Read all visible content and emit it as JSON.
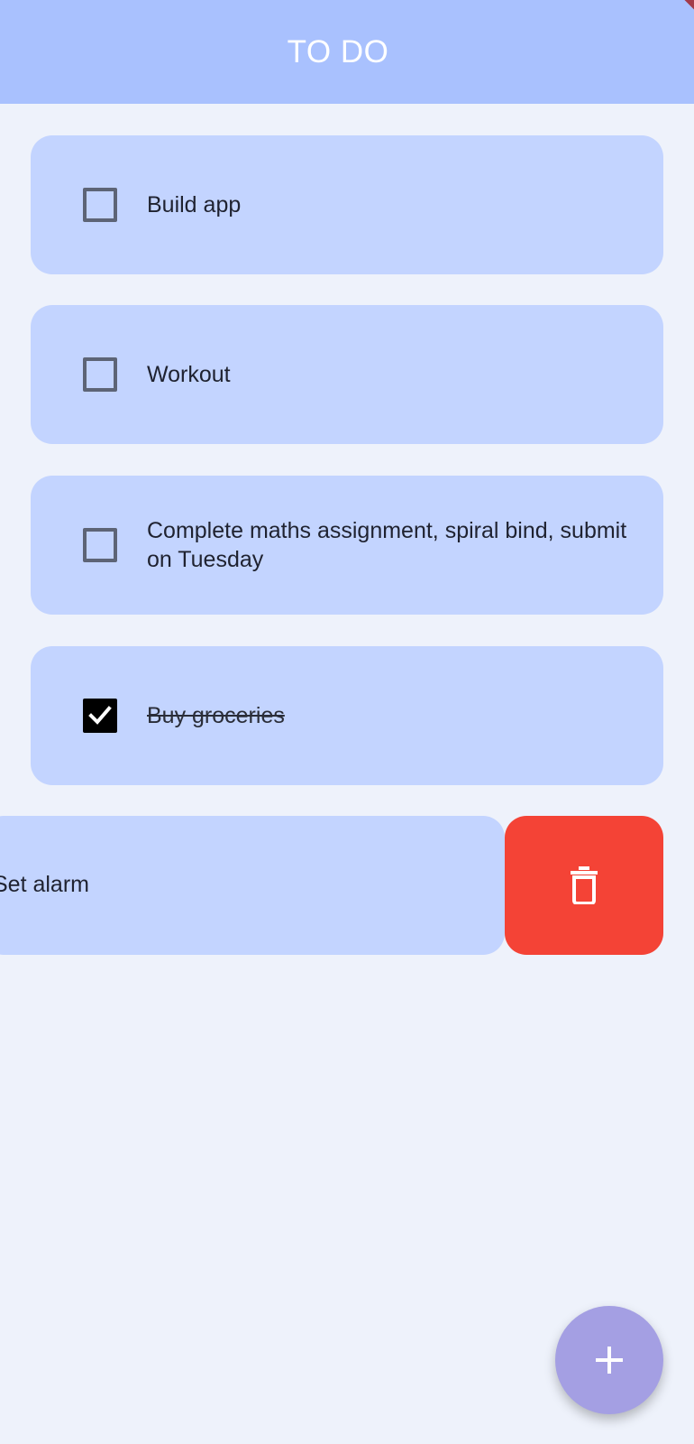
{
  "app_bar": {
    "title": "TO DO"
  },
  "tasks": [
    {
      "label": "Build app",
      "checked": false
    },
    {
      "label": "Workout",
      "checked": false
    },
    {
      "label": "Complete maths assignment, spiral bind, submit on Tuesday",
      "checked": false
    },
    {
      "label": "Buy groceries",
      "checked": true
    }
  ],
  "swiped_task": {
    "label": "Set alarm",
    "action_icon": "trash-icon"
  },
  "fab": {
    "icon": "plus-icon"
  },
  "colors": {
    "app_bar": "#a9c1fe",
    "card": "#c3d4ff",
    "delete": "#f44336",
    "fab": "#a49fe3",
    "background": "#eef2fb"
  }
}
